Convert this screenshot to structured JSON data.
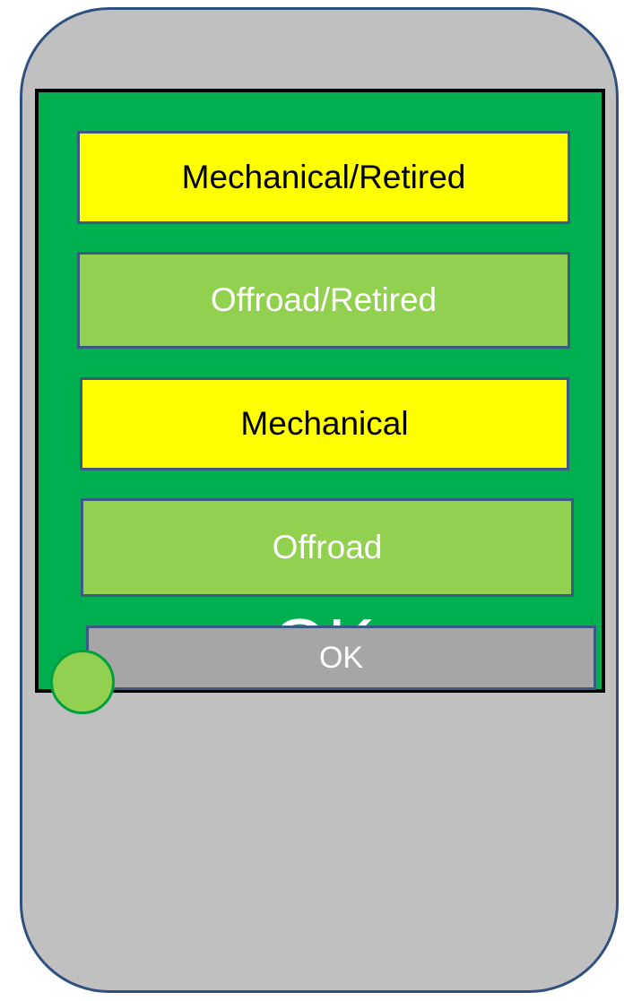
{
  "options": [
    {
      "label": "Mechanical/Retired",
      "color": "#ffff00"
    },
    {
      "label": "Offroad/Retired",
      "color": "#92d050"
    },
    {
      "label": "Mechanical",
      "color": "#ffff00"
    },
    {
      "label": "Offroad",
      "color": "#92d050"
    }
  ],
  "status": {
    "text": "OK"
  },
  "slider": {
    "label": "OK"
  },
  "colors": {
    "screen_bg": "#00b050",
    "phone_bg": "#c0c0c0",
    "slider_bg": "#a6a6a6",
    "knob": "#92d050"
  }
}
